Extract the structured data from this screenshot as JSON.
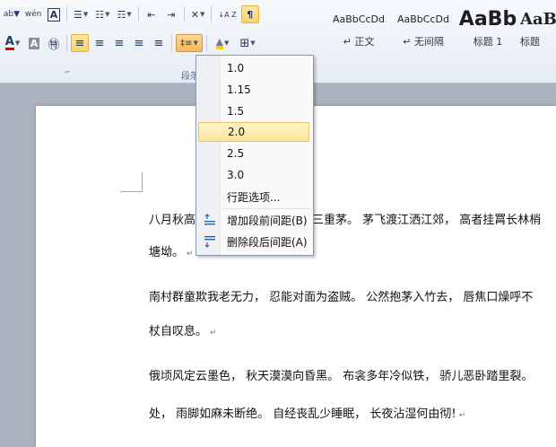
{
  "toolbar": {
    "row1": {
      "ab_icon": "ab▼",
      "wen_icon": "wén",
      "char_border": "A",
      "bullets": "☰",
      "numbering": "☷",
      "multilevel": "☶",
      "decrease_indent": "⇤",
      "increase_indent": "⇥",
      "chinese_layout": "✕",
      "sort": "↓A Z",
      "show_marks": "¶"
    },
    "row2": {
      "font_color": "A",
      "char_shading": "A",
      "enclose_char": "㊕",
      "align_left": "≡",
      "center": "≡",
      "align_right": "≡",
      "justify": "≡",
      "distributed": "≡",
      "line_spacing": "‡≡",
      "shading": "▲",
      "borders": "⊞"
    },
    "group_labels": {
      "paragraph": "段落",
      "launcher": "⌐"
    },
    "colors": {
      "font_red": "#e00000",
      "accent_yellow": "#f9d36b"
    }
  },
  "styles": [
    {
      "sample": "AaBbCcDd",
      "name": "↵ 正文"
    },
    {
      "sample": "AaBbCcDd",
      "name": "↵ 无间隔"
    },
    {
      "sample": "AaBb",
      "name": "标题 1"
    },
    {
      "sample": "AaB",
      "name": "标题"
    }
  ],
  "line_spacing_menu": {
    "items": [
      "1.0",
      "1.15",
      "1.5",
      "2.0",
      "2.5",
      "3.0",
      "行距选项..."
    ],
    "selected": "2.0",
    "add_space_before": "增加段前间距(B)",
    "remove_space_after": "删除段后间距(A)"
  },
  "document": {
    "paragraphs": [
      {
        "text": "八月秋高",
        "tail": "三重茅。 茅飞渡江洒江郊， 高者挂罥长林梢",
        "mark": false
      },
      {
        "text": "塘坳。",
        "tail": "",
        "mark": true
      },
      {
        "text": "南村群童欺我老无力， 忍能对面为盗贼。 公然抱茅入竹去， 唇焦口燥呼不",
        "tail": "",
        "mark": false
      },
      {
        "text": "杖自叹息。",
        "tail": "",
        "mark": true
      },
      {
        "text": "俄顷风定云墨色， 秋天漠漠向昏黑。 布衾多年冷似铁， 骄儿恶卧踏里裂。",
        "tail": "",
        "mark": false
      },
      {
        "text": "处， 雨脚如麻未断绝。 自经丧乱少睡眠， 长夜沾湿何由彻!",
        "tail": "",
        "mark": true
      }
    ],
    "paragraph_mark": "↵"
  }
}
